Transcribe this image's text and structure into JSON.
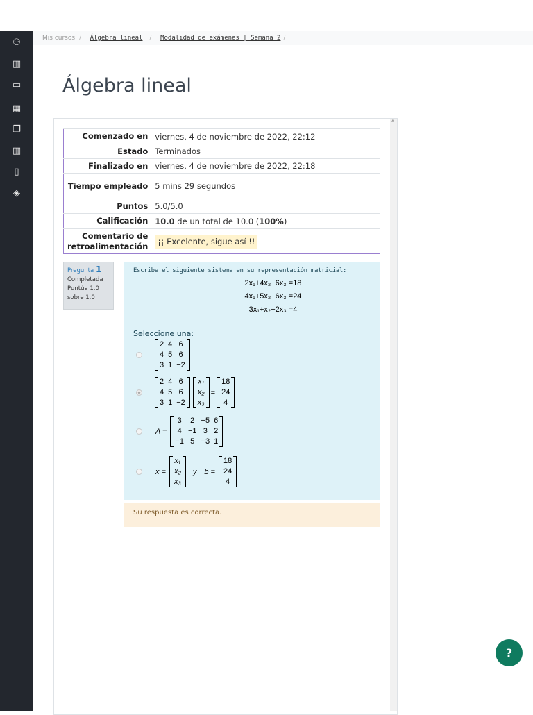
{
  "breadcrumb": {
    "items": [
      "Mis cursos",
      "Álgebra lineal",
      "Modalidad de exámenes | Semana 2"
    ]
  },
  "page_title": "Álgebra lineal",
  "summary": [
    {
      "label": "Comenzado en",
      "value": "viernes, 4 de noviembre de 2022, 22:12"
    },
    {
      "label": "Estado",
      "value": "Terminados"
    },
    {
      "label": "Finalizado en",
      "value": "viernes, 4 de noviembre de 2022, 22:18"
    },
    {
      "label": "Tiempo empleado",
      "value": "5 mins 29 segundos"
    },
    {
      "label": "Puntos",
      "value": "5.0/5.0"
    },
    {
      "label": "Calificación",
      "value_bold": "10.0",
      "value_rest": " de un total de 10.0 (",
      "value_pct": "100%",
      "value_end": ")"
    },
    {
      "label": "Comentario de retroalimentación",
      "value": "¡¡ Excelente, sigue así !!"
    }
  ],
  "question_info": {
    "label": "Pregunta",
    "number": "1",
    "state": "Completada",
    "grade": "Puntúa 1.0 sobre 1.0"
  },
  "question": {
    "text": "Escribe el siguiente sistema en su representación matricial:",
    "equations": [
      "2x₁+4x₂+6x₃ =18",
      "4x₁+5x₂+6x₃ =24",
      "3x₁+x₂−2x₃ =4"
    ],
    "select_label": "Seleccione una:",
    "options": {
      "A": [
        [
          "2",
          "4",
          "6"
        ],
        [
          "4",
          "5",
          "6"
        ],
        [
          "3",
          "1",
          "−2"
        ]
      ],
      "x": [
        [
          "x₁"
        ],
        [
          "x₂"
        ],
        [
          "x₃"
        ]
      ],
      "b": [
        [
          "18"
        ],
        [
          "24"
        ],
        [
          "4"
        ]
      ],
      "C": [
        [
          "3",
          "2",
          "−5",
          "6"
        ],
        [
          "4",
          "−1",
          "3",
          "2"
        ],
        [
          "−1",
          "5",
          "−3",
          "1"
        ]
      ],
      "eq": "=",
      "A_label": "A =",
      "x_label": "x =",
      "y_label": "y",
      "b_label": "b ="
    },
    "selected_option": 2
  },
  "feedback": "Su respuesta es correcta.",
  "help_label": "?"
}
